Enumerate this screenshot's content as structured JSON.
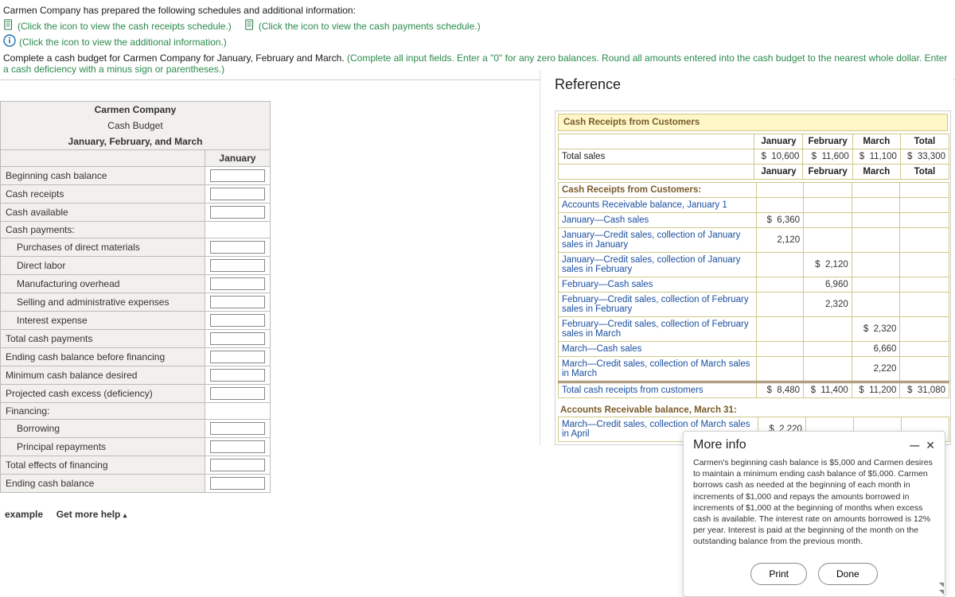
{
  "header": {
    "line1": "Carmen Company has prepared the following schedules and additional information:",
    "cash_receipts_link": "(Click the icon to view the cash receipts schedule.)",
    "cash_payments_link": "(Click the icon to view the cash payments schedule.)",
    "additional_info_link": "(Click the icon to view the additional information.)",
    "instruction_black": "Complete a cash budget for Carmen Company for January, February and March. ",
    "instruction_green": "(Complete all input fields. Enter a \"0\" for any zero balances. Round all amounts entered into the cash budget to the nearest whole dollar. Enter a cash deficiency with a minus sign or parentheses.)"
  },
  "budget": {
    "company": "Carmen Company",
    "title": "Cash Budget",
    "period": "January, February, and March",
    "col1": "January",
    "rows": [
      "Beginning cash balance",
      "Cash receipts",
      "Cash available",
      "Cash payments:",
      "Purchases of direct materials",
      "Direct labor",
      "Manufacturing overhead",
      "Selling and administrative expenses",
      "Interest expense",
      "Total cash payments",
      "Ending cash balance before financing",
      "Minimum cash balance desired",
      "Projected cash excess (deficiency)",
      "Financing:",
      "Borrowing",
      "Principal repayments",
      "Total effects of financing",
      "Ending cash balance"
    ],
    "indent_rows": [
      4,
      5,
      6,
      7,
      8,
      14,
      15
    ],
    "no_input_rows": [
      3,
      13
    ]
  },
  "footer": {
    "example": "example",
    "help": "Get more help",
    "caret": "▴"
  },
  "reference": {
    "title": "Reference",
    "section1": "Cash Receipts from Customers",
    "months": [
      "January",
      "February",
      "March",
      "Total"
    ],
    "total_sales": {
      "label": "Total sales",
      "jan": "10,600",
      "feb": "11,600",
      "mar": "11,100",
      "tot": "33,300"
    },
    "section1b": "Cash Receipts from Customers:",
    "detail_rows": [
      {
        "label": "Accounts Receivable balance, January 1",
        "jan": "",
        "feb": "",
        "mar": ""
      },
      {
        "label": "January—Cash sales",
        "jan_d": "$",
        "jan": "6,360",
        "feb": "",
        "mar": ""
      },
      {
        "label": "January—Credit sales, collection of January sales in January",
        "jan": "2,120",
        "feb": "",
        "mar": ""
      },
      {
        "label": "January—Credit sales, collection of January sales in February",
        "jan": "",
        "feb_d": "$",
        "feb": "2,120",
        "mar": ""
      },
      {
        "label": "February—Cash sales",
        "jan": "",
        "feb": "6,960",
        "mar": ""
      },
      {
        "label": "February—Credit sales, collection of February sales in February",
        "jan": "",
        "feb": "2,320",
        "mar": ""
      },
      {
        "label": "February—Credit sales, collection of February sales in March",
        "jan": "",
        "feb": "",
        "mar_d": "$",
        "mar": "2,320"
      },
      {
        "label": "March—Cash sales",
        "jan": "",
        "feb": "",
        "mar": "6,660"
      },
      {
        "label": "March—Credit sales, collection of March sales in March",
        "jan": "",
        "feb": "",
        "mar": "2,220"
      }
    ],
    "total_receipts": {
      "label": "Total cash receipts from customers",
      "jan": "8,480",
      "feb": "11,400",
      "mar": "11,200",
      "tot": "31,080"
    },
    "ar_balance_head": "Accounts Receivable balance, March 31:",
    "ar_row": {
      "label": "March—Credit sales, collection of March sales in April",
      "jan_d": "$",
      "jan": "2,220"
    }
  },
  "moreinfo": {
    "title": "More info",
    "body": "Carmen's beginning cash balance is $5,000 and Carmen desires to maintain a minimum ending cash balance of $5,000. Carmen borrows cash as needed at the beginning of each month in increments of $1,000 and repays the amounts borrowed in increments of $1,000 at the beginning of months when excess cash is available. The interest rate on amounts borrowed is 12% per year. Interest is paid at the beginning of the month on the outstanding balance from the previous month.",
    "print": "Print",
    "done": "Done"
  }
}
